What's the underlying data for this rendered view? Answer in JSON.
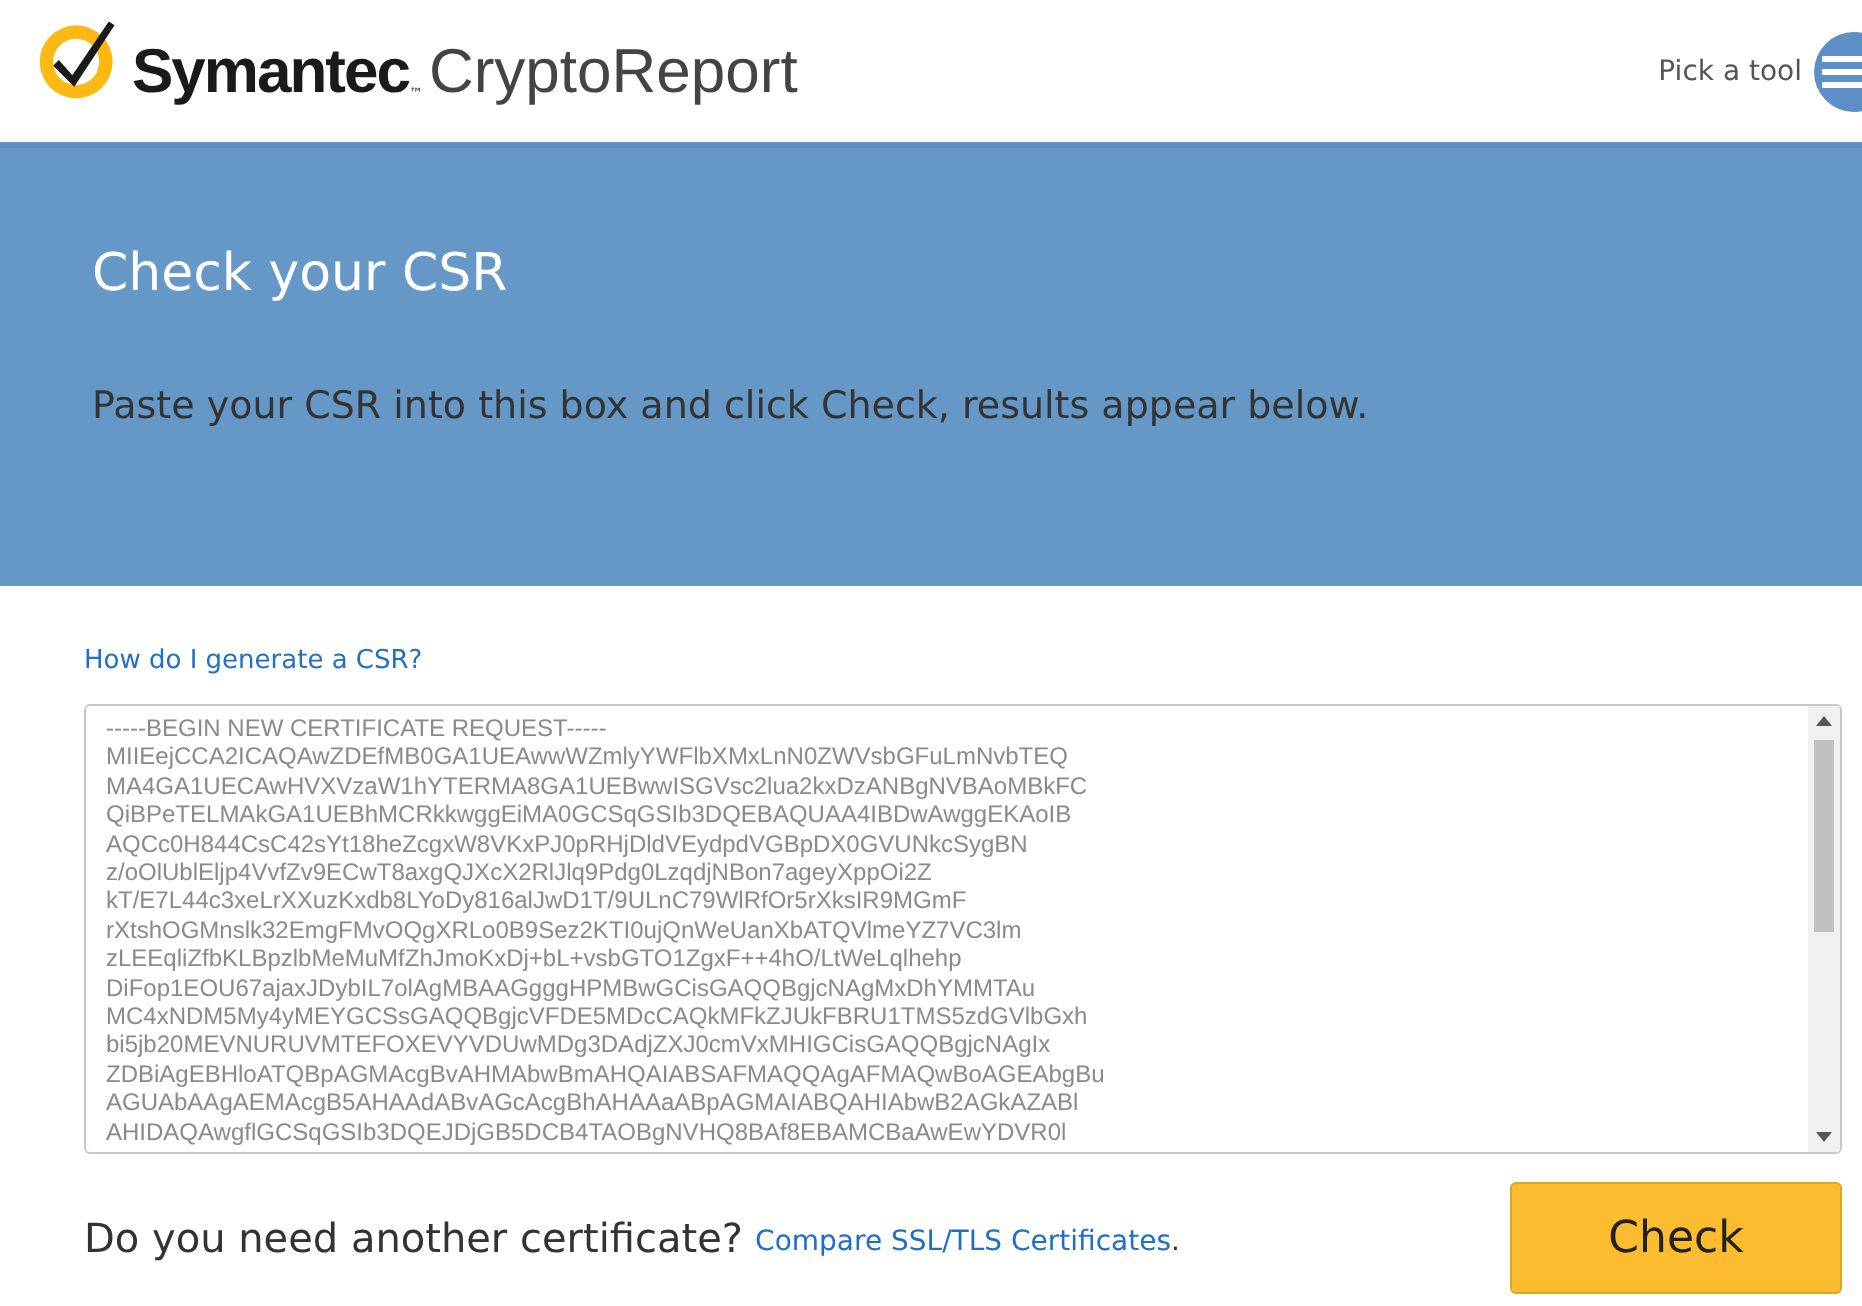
{
  "header": {
    "brand": "Symantec",
    "brand_mark": "™",
    "product": "CryptoReport",
    "menu_label": "Pick a tool"
  },
  "banner": {
    "title": "Check your CSR",
    "subtitle": "Paste your CSR into this box and click Check, results appear below."
  },
  "help_link": "How do I generate a CSR?",
  "csr_field": {
    "lines": [
      "-----BEGIN NEW CERTIFICATE REQUEST-----",
      "MIIEejCCA2ICAQAwZDEfMB0GA1UEAwwWZmlyYWFlbXMxLnN0ZWVsbGFuLmNvbTEQ",
      "MA4GA1UECAwHVXVzaW1hYTERMA8GA1UEBwwISGVsc2lua2kxDzANBgNVBAoMBkFC",
      "QiBPeTELMAkGA1UEBhMCRkkwggEiMA0GCSqGSIb3DQEBAQUAA4IBDwAwggEKAoIB",
      "AQCc0H844CsC42sYt18heZcgxW8VKxPJ0pRHjDldVEydpdVGBpDX0GVUNkcSygBN",
      "z/oOlUblEljp4VvfZv9ECwT8axgQJXcX2RlJlq9Pdg0LzqdjNBon7ageyXppOi2Z",
      "kT/E7L44c3xeLrXXuzKxdb8LYoDy816alJwD1T/9ULnC79WlRfOr5rXksIR9MGmF",
      "rXtshOGMnslk32EmgFMvOQgXRLo0B9Sez2KTI0ujQnWeUanXbATQVlmeYZ7VC3lm",
      "zLEEqliZfbKLBpzlbMeMuMfZhJmoKxDj+bL+vsbGTO1ZgxF++4hO/LtWeLqlhehp",
      "DiFop1EOU67ajaxJDybIL7olAgMBAAGgggHPMBwGCisGAQQBgjcNAgMxDhYMMTAu",
      "MC4xNDM5My4yMEYGCSsGAQQBgjcVFDE5MDcCAQkMFkZJUkFBRU1TMS5zdGVlbGxh",
      "bi5jb20MEVNURUVMTEFOXEVYVDUwMDg3DAdjZXJ0cmVxMHIGCisGAQQBgjcNAgIx",
      "ZDBiAgEBHloATQBpAGMAcgBvAHMAbwBmAHQAIABSAFMAQQAgAFMAQwBoAGEAbgBu",
      "AGUAbAAgAEMAcgB5AHAAdABvAGcAcgBhAHAAaABpAGMAIABQAHIAbwB2AGkAZABl",
      "AHIDAQAwgflGCSqGSIb3DQEJDjGB5DCB4TAOBgNVHQ8BAf8EBAMCBaAwEwYDVR0l"
    ]
  },
  "footer": {
    "question": "Do you need another certificate?",
    "link": "Compare SSL/TLS Certificates",
    "period": ".",
    "button": "Check"
  }
}
